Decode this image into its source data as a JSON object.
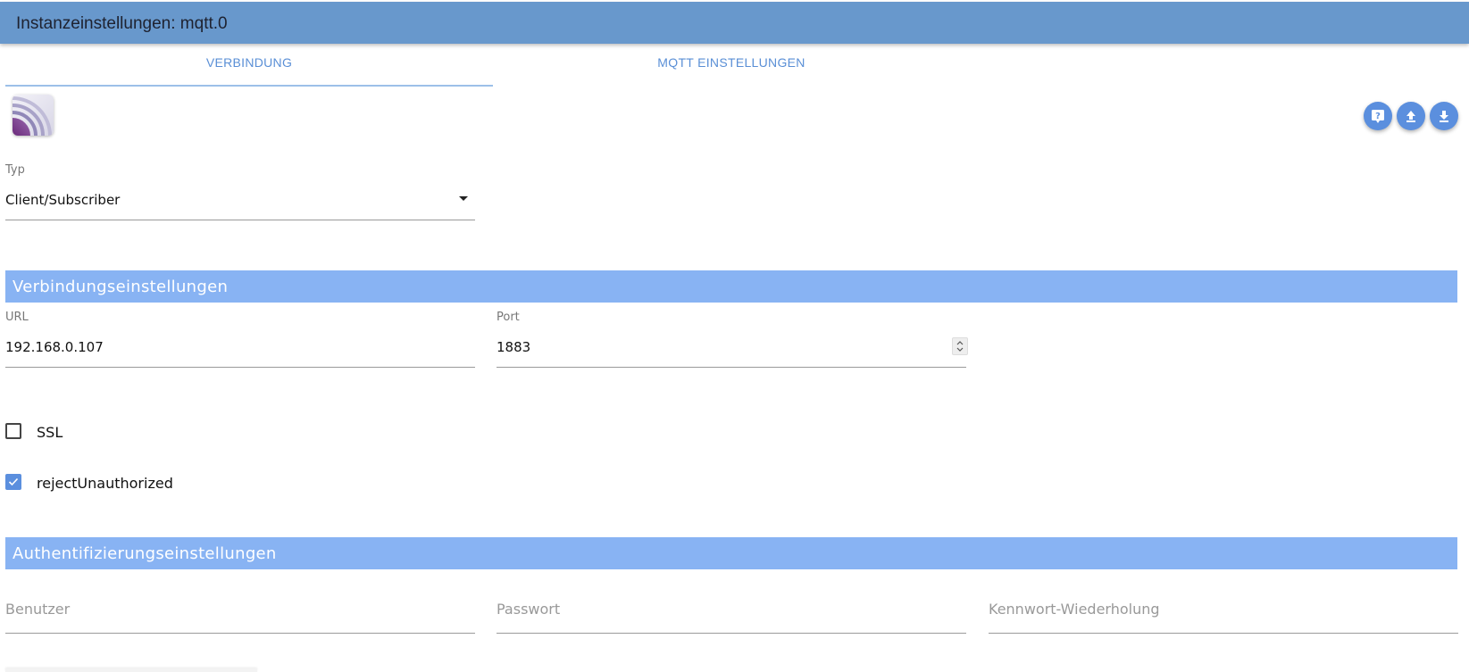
{
  "window": {
    "title": "Instanzeinstellungen: mqtt.0"
  },
  "tabs": [
    {
      "label": "VERBINDUNG",
      "active": true
    },
    {
      "label": "MQTT EINSTELLUNGEN",
      "active": false
    }
  ],
  "toolbar": {
    "icons": [
      "help-icon",
      "upload-icon",
      "download-icon"
    ],
    "accent_color": "#5b8fde"
  },
  "typ": {
    "label": "Typ",
    "value": "Client/Subscriber"
  },
  "sections": {
    "connection": "Verbindungseinstellungen",
    "auth": "Authentifizierungseinstellungen"
  },
  "connection": {
    "url_label": "URL",
    "url_value": "192.168.0.107",
    "port_label": "Port",
    "port_value": "1883"
  },
  "options": {
    "ssl": {
      "label": "SSL",
      "checked": false
    },
    "reject": {
      "label": "rejectUnauthorized",
      "checked": true
    }
  },
  "auth": {
    "user_label": "Benutzer",
    "password_label": "Passwort",
    "repeat_label": "Kennwort-Wiederholung"
  },
  "colors": {
    "titlebar": "#6898cc",
    "section": "#88b3f3",
    "tab_text": "#5a8fd6"
  }
}
